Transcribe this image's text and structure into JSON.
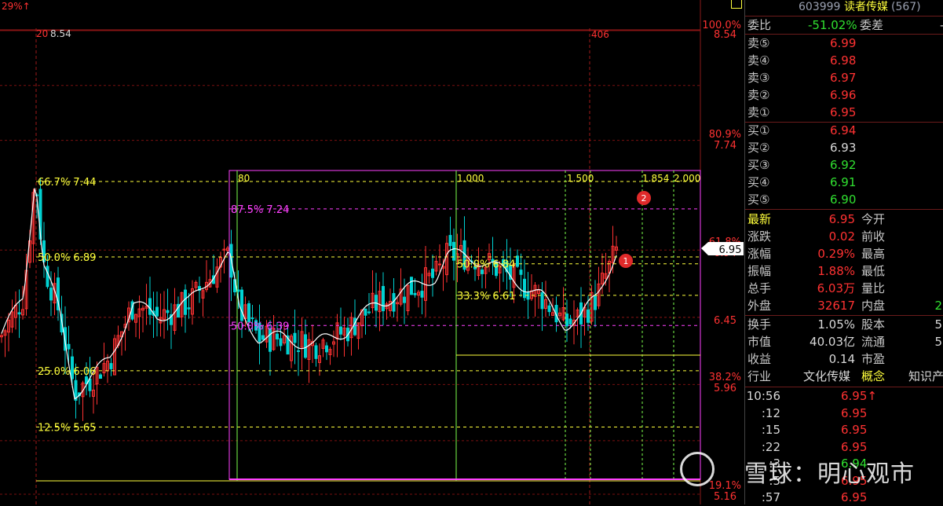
{
  "stock": {
    "code": "603999",
    "name": "读者传媒",
    "suffix": "(567)"
  },
  "chart": {
    "top_left_label": "29%↑",
    "corner_labels": {
      "left": "20",
      "top_value": "8.54",
      "right": "406"
    },
    "left_levels": [
      {
        "text": "66.7% 7.44",
        "price": 7.44
      },
      {
        "text": "50.0% 6.89",
        "price": 6.89
      },
      {
        "text": "25.0% 6.06",
        "price": 6.06
      },
      {
        "text": "12.5% 5.65",
        "price": 5.65
      }
    ],
    "mid_levels": [
      {
        "text": "87.5% 7.24",
        "price": 7.24
      },
      {
        "text": "50.0% 6.39",
        "price": 6.39
      }
    ],
    "right_levels": [
      {
        "text": "50.0% 6.84",
        "price": 6.84
      },
      {
        "text": "33.3% 6.61",
        "price": 6.61
      }
    ],
    "top_marks": [
      "80",
      "1.000",
      "1.500",
      "1.854",
      "2.000"
    ],
    "axis": [
      {
        "pct": "100.0%",
        "price": "8.54"
      },
      {
        "pct": "80.9%",
        "price": "7.74"
      },
      {
        "pct": "61.8%",
        "price": "6.94"
      },
      {
        "pct": "",
        "price": "6.45"
      },
      {
        "pct": "38.2%",
        "price": "5.96"
      },
      {
        "pct": "19.1%",
        "price": "5.16"
      }
    ],
    "current_price": "6.95",
    "badges": [
      "1",
      "2"
    ],
    "ylim": [
      5.12,
      8.58
    ],
    "colors": {
      "up": "#ff3232",
      "down": "#00d2d2",
      "ma": "#ffffff",
      "yellow": "#ffff3c",
      "magenta": "#ff40ff",
      "green": "#7cff4c"
    }
  },
  "quote": {
    "weibi_label": "委比",
    "weibi_value": "-51.02%",
    "weicha_label": "委差",
    "weicha_value": "-",
    "sells": [
      {
        "label": "卖⑤",
        "price": "6.99"
      },
      {
        "label": "卖④",
        "price": "6.98"
      },
      {
        "label": "卖③",
        "price": "6.97"
      },
      {
        "label": "卖②",
        "price": "6.96"
      },
      {
        "label": "卖①",
        "price": "6.95"
      }
    ],
    "buys": [
      {
        "label": "买①",
        "price": "6.94"
      },
      {
        "label": "买②",
        "price": "6.93"
      },
      {
        "label": "买③",
        "price": "6.92"
      },
      {
        "label": "买④",
        "price": "6.91"
      },
      {
        "label": "买⑤",
        "price": "6.90"
      }
    ],
    "stats": [
      {
        "l1": "最新",
        "v1": "6.95",
        "l2": "今开",
        "v2": ""
      },
      {
        "l1": "涨跌",
        "v1": "0.02",
        "l2": "前收",
        "v2": ""
      },
      {
        "l1": "涨幅",
        "v1": "0.29%",
        "l2": "最高",
        "v2": ""
      },
      {
        "l1": "振幅",
        "v1": "1.88%",
        "l2": "最低",
        "v2": ""
      },
      {
        "l1": "总手",
        "v1": "6.03万",
        "l2": "量比",
        "v2": ""
      },
      {
        "l1": "外盘",
        "v1": "32617",
        "l2": "内盘",
        "v2": "2"
      }
    ],
    "stats2": [
      {
        "l1": "换手",
        "v1": "1.05%",
        "l2": "股本",
        "v2": "5"
      },
      {
        "l1": "市值",
        "v1": "40.03亿",
        "l2": "流通",
        "v2": "5"
      },
      {
        "l1": "收益",
        "v1": "0.14",
        "l2": "市盈",
        "v2": ""
      }
    ],
    "industry": {
      "label": "行业",
      "value": "文化传媒",
      "concept_label": "概念",
      "concept_value": "知识产"
    }
  },
  "ticks": [
    {
      "time": "10:56",
      "price": "6.95↑"
    },
    {
      "time": ":12",
      "price": "6.95"
    },
    {
      "time": ":15",
      "price": "6.95"
    },
    {
      "time": ":22",
      "price": "6.95"
    },
    {
      "time": ":3",
      "price": "6.94"
    },
    {
      "time": ":5",
      "price": "6.95"
    },
    {
      "time": ":57",
      "price": "6.95"
    }
  ],
  "watermark": "雪球：明心观市"
}
